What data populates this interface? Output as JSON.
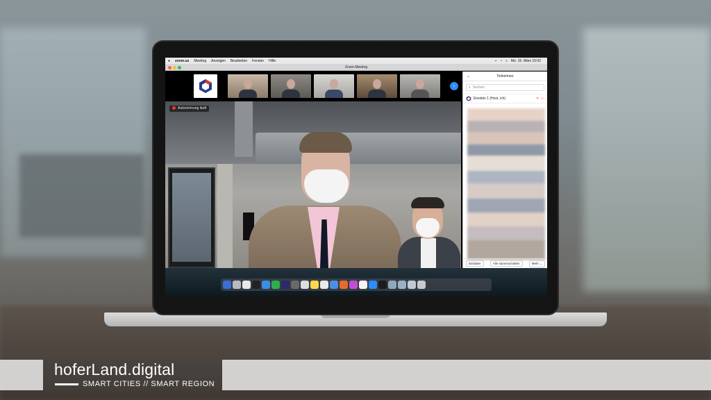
{
  "menubar": {
    "apple": "",
    "app": "zoom.us",
    "items": [
      "Meeting",
      "Anzeigen",
      "Bearbeiten",
      "Fenster",
      "Hilfe"
    ],
    "clock": "Mo. 15. März 15:02"
  },
  "window": {
    "title": "Zoom-Meeting"
  },
  "recording": {
    "label": "Aufzeichnung läuft"
  },
  "participants": {
    "header": "Teilnehmer",
    "search_placeholder": "Suchen",
    "me": "Einstein 1 (Host, ich)",
    "footer": {
      "invite": "Einladen",
      "mute_all": "Alle stummschalten",
      "more": "Mehr ⌄"
    }
  },
  "branding": {
    "title": "hoferLand.digital",
    "subtitle": "SMART CITIES // SMART REGION"
  },
  "colors": {
    "accent": "#2d8cff",
    "record": "#e33333"
  },
  "icons": [
    "apple-icon",
    "chevron-right-icon",
    "search-icon",
    "mic-muted-icon",
    "video-off-icon"
  ]
}
